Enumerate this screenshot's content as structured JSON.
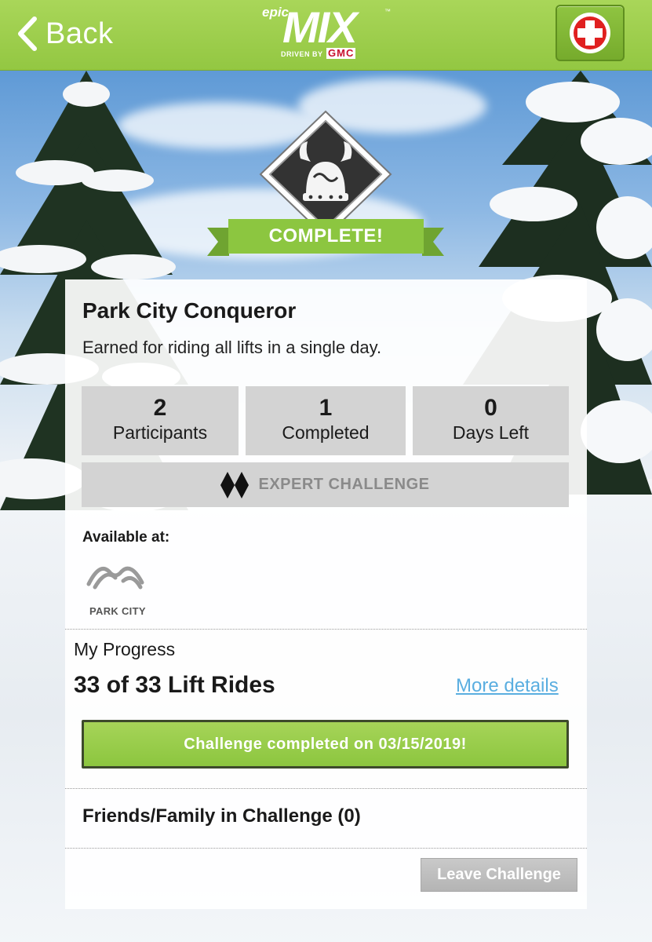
{
  "header": {
    "back_label": "Back",
    "logo": {
      "epic": "epic",
      "mix": "MIX",
      "trademark": "™",
      "driven_by": "DRIVEN BY",
      "sponsor": "GMC"
    },
    "help_icon": "medical-cross-icon"
  },
  "badge": {
    "icon": "viking-helmet-icon",
    "ribbon_label": "COMPLETE!"
  },
  "challenge": {
    "title": "Park City Conqueror",
    "description": "Earned for riding all lifts in a single day.",
    "stats": [
      {
        "value": "2",
        "label": "Participants"
      },
      {
        "value": "1",
        "label": "Completed"
      },
      {
        "value": "0",
        "label": "Days Left"
      }
    ],
    "difficulty_icon": "double-black-diamond-icon",
    "difficulty_label": "EXPERT CHALLENGE",
    "available_label": "Available at:",
    "resort_name": "PARK CITY"
  },
  "progress": {
    "title": "My Progress",
    "count": "33 of 33 Lift Rides",
    "more_details": "More details",
    "completed_message": "Challenge completed on 03/15/2019!",
    "fraction": 1.0
  },
  "friends": {
    "label": "Friends/Family in Challenge (0)"
  },
  "actions": {
    "leave_label": "Leave Challenge"
  },
  "colors": {
    "brand_green": "#8cc63f",
    "link_blue": "#5aaee0",
    "stat_gray": "#d3d3d3",
    "help_red": "#e02020"
  }
}
